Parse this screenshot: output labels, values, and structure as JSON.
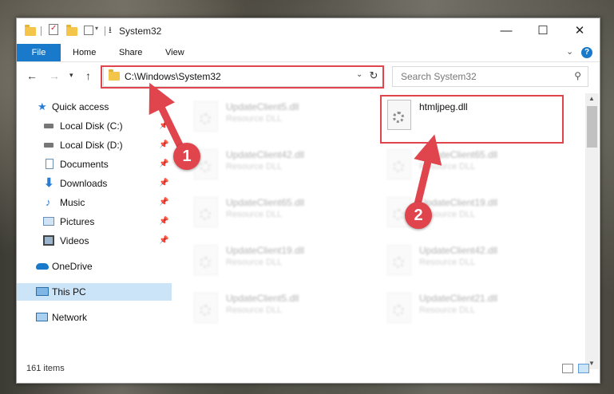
{
  "window": {
    "title": "System32",
    "controls": {
      "minimize": "—",
      "maximize": "☐",
      "close": "✕"
    }
  },
  "ribbon": {
    "tabs": [
      "File",
      "Home",
      "Share",
      "View"
    ],
    "expand_icon": "chevron-down",
    "help": "?"
  },
  "address": {
    "path": "C:\\Windows\\System32",
    "search_placeholder": "Search System32"
  },
  "sidebar": {
    "items": [
      {
        "label": "Quick access",
        "icon": "star-icon"
      },
      {
        "label": "Local Disk (C:)",
        "icon": "drive-icon",
        "pinned": true
      },
      {
        "label": "Local Disk (D:)",
        "icon": "drive-icon",
        "pinned": true
      },
      {
        "label": "Documents",
        "icon": "documents-icon",
        "pinned": true
      },
      {
        "label": "Downloads",
        "icon": "download-icon",
        "pinned": true
      },
      {
        "label": "Music",
        "icon": "music-icon",
        "pinned": true
      },
      {
        "label": "Pictures",
        "icon": "pictures-icon",
        "pinned": true
      },
      {
        "label": "Videos",
        "icon": "videos-icon",
        "pinned": true
      },
      {
        "label": "OneDrive",
        "icon": "cloud-icon"
      },
      {
        "label": "This PC",
        "icon": "computer-icon",
        "selected": true
      },
      {
        "label": "Network",
        "icon": "network-icon"
      }
    ]
  },
  "files": [
    {
      "name": "UpdateClient5.dll",
      "type": "Resource DLL"
    },
    {
      "name": "htmljpeg.dll",
      "type": "",
      "highlighted": true
    },
    {
      "name": "UpdateClient42.dll",
      "type": "Resource DLL"
    },
    {
      "name": "UpdateClient65.dll",
      "type": "Resource DLL"
    },
    {
      "name": "UpdateClient65.dll",
      "type": "Resource DLL"
    },
    {
      "name": "UpdateClient19.dll",
      "type": "Resource DLL"
    },
    {
      "name": "UpdateClient19.dll",
      "type": "Resource DLL"
    },
    {
      "name": "UpdateClient42.dll",
      "type": "Resource DLL"
    },
    {
      "name": "UpdateClient5.dll",
      "type": "Resource DLL"
    },
    {
      "name": "UpdateClient21.dll",
      "type": "Resource DLL"
    }
  ],
  "status": {
    "items_count": "161 items"
  },
  "annotations": {
    "step1": "1",
    "step2": "2",
    "color": "#e0444c"
  }
}
